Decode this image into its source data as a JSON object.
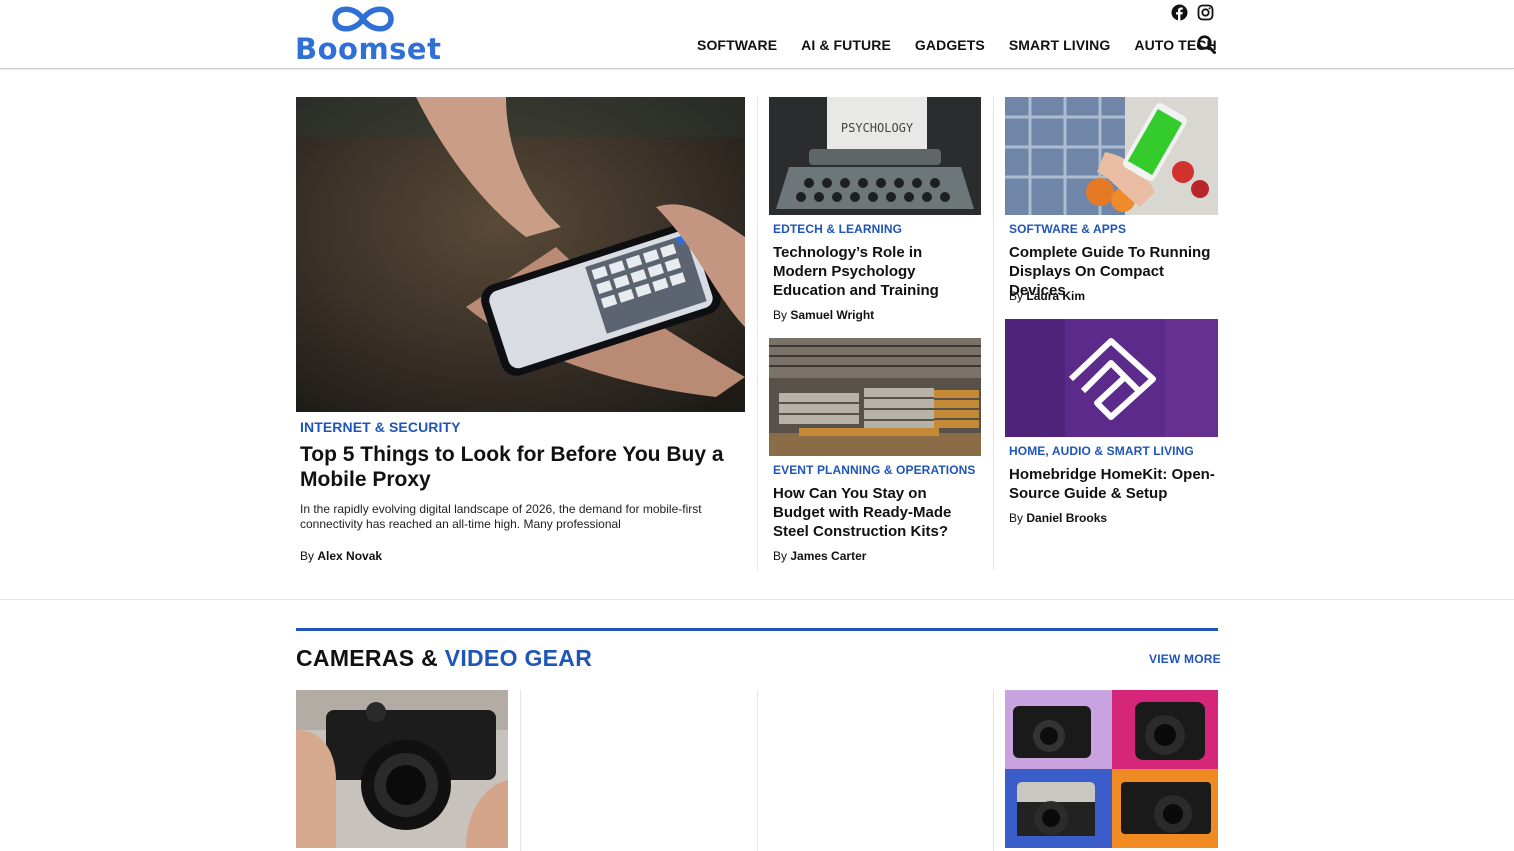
{
  "brand": {
    "name": "Boomset",
    "color": "#2f6fd6"
  },
  "social": [
    {
      "icon": "facebook-icon"
    },
    {
      "icon": "instagram-icon"
    }
  ],
  "nav": {
    "items": [
      "SOFTWARE",
      "AI & FUTURE",
      "GADGETS",
      "SMART LIVING",
      "AUTO TECH"
    ],
    "search_icon": "search-icon"
  },
  "featured": {
    "category": "INTERNET & SECURITY",
    "title": "Top 5 Things to Look for Before You Buy a Mobile Proxy",
    "excerpt": "In the rapidly evolving digital landscape of 2026, the demand for mobile-first connectivity has reached an all-time high. Many professional",
    "by": "By",
    "author": "Alex Novak"
  },
  "articles": [
    {
      "category": "EDTECH & LEARNING",
      "title": "Technology’s Role in Modern Psychology Education and Training",
      "by": "By",
      "author": "Samuel Wright",
      "image_text": "PSYCHOLOGY"
    },
    {
      "category": "SOFTWARE & APPS",
      "title": "Complete Guide To Running Displays On Compact Devices",
      "by": "By",
      "author": "Laura Kim"
    },
    {
      "category": "EVENT PLANNING & OPERATIONS",
      "title": "How Can You Stay on Budget with Ready-Made Steel Construction Kits?",
      "by": "By",
      "author": "James Carter"
    },
    {
      "category": "HOME, AUDIO & SMART LIVING",
      "title": "Homebridge HomeKit: Open-Source Guide & Setup",
      "by": "By",
      "author": "Daniel Brooks"
    }
  ],
  "section": {
    "title_plain": "CAMERAS &",
    "title_accent": "VIDEO GEAR",
    "view_more": "VIEW MORE",
    "accent_color": "#1f55b9"
  }
}
